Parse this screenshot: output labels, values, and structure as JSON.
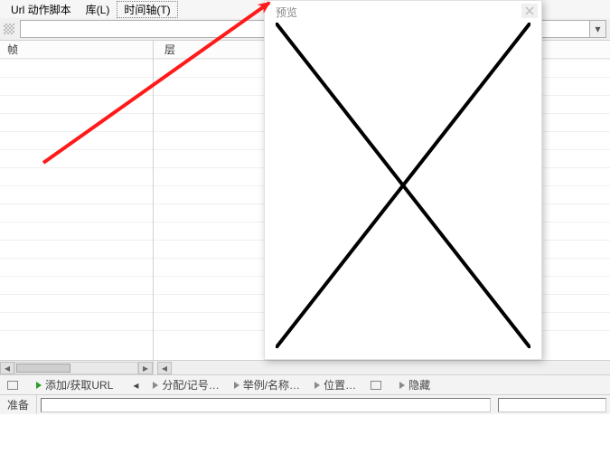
{
  "menubar": {
    "url_script_label": "Url 动作脚本",
    "library_label": "库(L)",
    "timeline_label": "时间轴(T)"
  },
  "toolbar": {
    "combo_value": ""
  },
  "panels": {
    "left_header": "帧",
    "center_header": "层"
  },
  "actions": {
    "add_get_url": "添加/获取URL",
    "assign": "分配/记号…",
    "example": "举例/名称…",
    "position": "位置…",
    "hide": "隐藏"
  },
  "status": {
    "ready": "准备"
  },
  "preview": {
    "title": "预览"
  },
  "icons": {
    "chevron_down": "▾",
    "chevron_left": "◂",
    "chevron_right": "▸"
  }
}
